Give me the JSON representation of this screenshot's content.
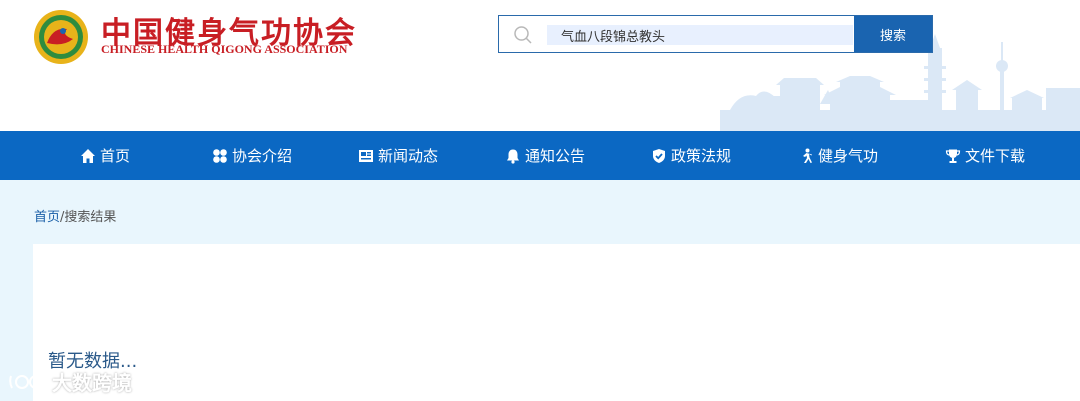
{
  "header": {
    "brand_cn": "中国健身气功协会",
    "brand_en": "CHINESE HEALTH QIGONG ASSOCIATION"
  },
  "search": {
    "value": "气血八段锦总教头",
    "button_label": "搜索"
  },
  "nav": {
    "items": [
      {
        "label": "首页",
        "icon": "home-icon"
      },
      {
        "label": "协会介绍",
        "icon": "grid-icon"
      },
      {
        "label": "新闻动态",
        "icon": "newspaper-icon"
      },
      {
        "label": "通知公告",
        "icon": "bell-icon"
      },
      {
        "label": "政策法规",
        "icon": "shield-check-icon"
      },
      {
        "label": "健身气功",
        "icon": "athlete-icon"
      },
      {
        "label": "文件下载",
        "icon": "trophy-icon"
      }
    ]
  },
  "breadcrumb": {
    "home": "首页",
    "separator": "/",
    "current": "搜索结果"
  },
  "results": {
    "empty_text": "暂无数据..."
  },
  "watermark": {
    "text": "大数跨境"
  },
  "colors": {
    "brand_red": "#c81e24",
    "nav_blue": "#0b68c3",
    "button_blue": "#1a64b0",
    "page_bg": "#e9f6fd"
  }
}
